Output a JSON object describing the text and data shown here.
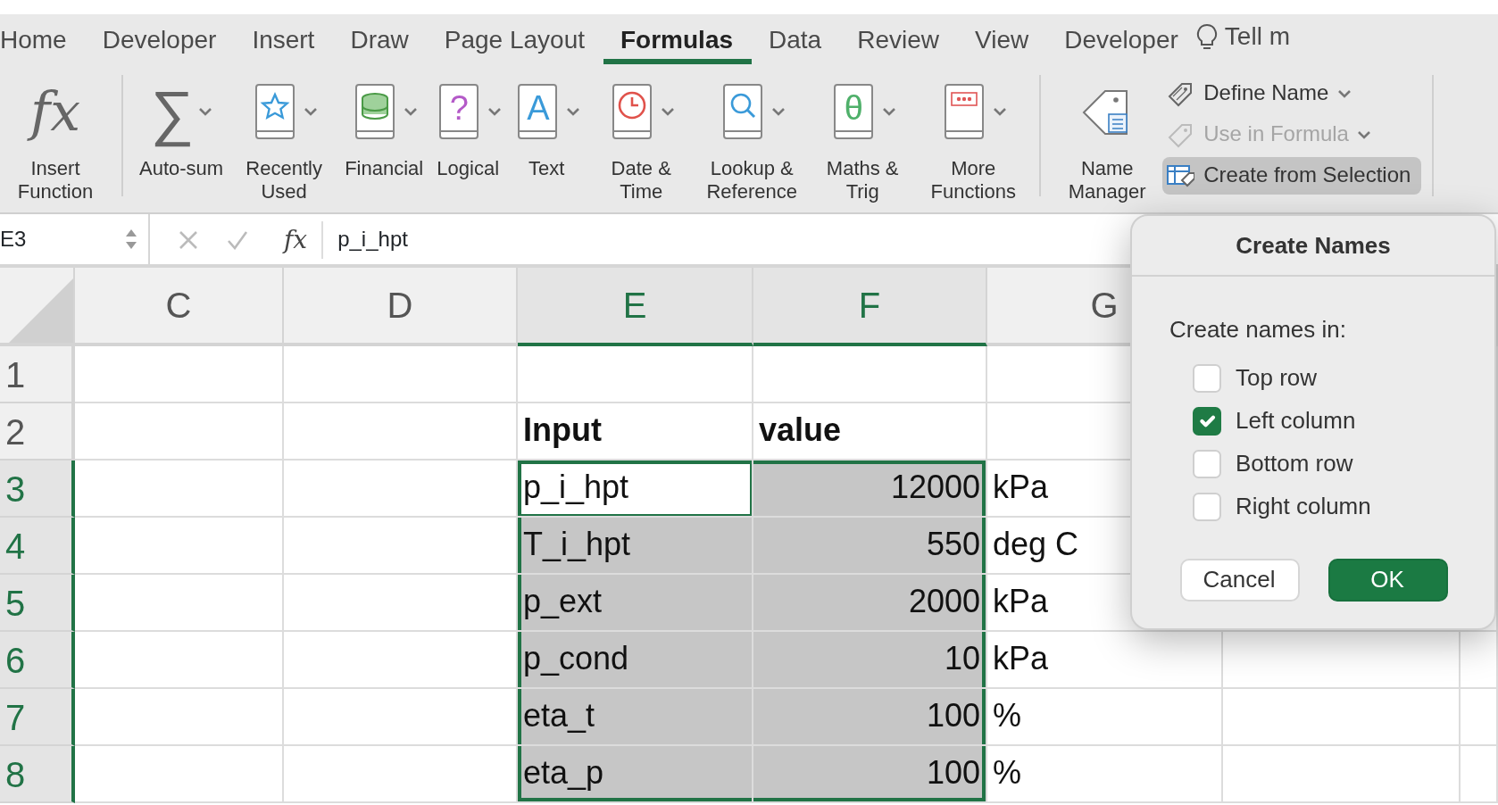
{
  "tabs": [
    {
      "label": "Home",
      "selected": false
    },
    {
      "label": "Developer",
      "selected": false
    },
    {
      "label": "Insert",
      "selected": false
    },
    {
      "label": "Draw",
      "selected": false
    },
    {
      "label": "Page Layout",
      "selected": false
    },
    {
      "label": "Formulas",
      "selected": true
    },
    {
      "label": "Data",
      "selected": false
    },
    {
      "label": "Review",
      "selected": false
    },
    {
      "label": "View",
      "selected": false
    },
    {
      "label": "Developer",
      "selected": false
    }
  ],
  "tell_me": "Tell m",
  "ribbon": {
    "insert_function": {
      "glyph": "fx",
      "label": "Insert Function"
    },
    "function_library": [
      {
        "label": "Auto-sum",
        "glyph": "∑"
      },
      {
        "label": "Recently Used"
      },
      {
        "label": "Financial"
      },
      {
        "label": "Logical",
        "glyph": "?"
      },
      {
        "label": "Text",
        "glyph": "A"
      },
      {
        "label": "Date & Time"
      },
      {
        "label": "Lookup & Reference"
      },
      {
        "label": "Maths & Trig",
        "glyph": "θ"
      },
      {
        "label": "More Functions"
      }
    ],
    "name_manager": {
      "label": "Name Manager"
    },
    "name_commands": [
      {
        "label": "Define Name",
        "disabled": false,
        "selected": false,
        "dropdown": true
      },
      {
        "label": "Use in Formula",
        "disabled": true,
        "selected": false,
        "dropdown": true
      },
      {
        "label": "Create from Selection",
        "disabled": false,
        "selected": true,
        "dropdown": false
      }
    ]
  },
  "formula_bar": {
    "name_box": "E3",
    "fx": "fx",
    "formula": "p_i_hpt"
  },
  "sheet": {
    "columns": [
      {
        "label": "C",
        "selected": false
      },
      {
        "label": "D",
        "selected": false
      },
      {
        "label": "E",
        "selected": true
      },
      {
        "label": "F",
        "selected": true
      },
      {
        "label": "G",
        "selected": false
      }
    ],
    "rows": [
      {
        "number": "1",
        "selected": false,
        "cells": [
          {
            "selected": false,
            "active": false
          },
          {
            "selected": false,
            "active": false
          },
          {
            "selected": false,
            "active": false
          },
          {
            "selected": false,
            "active": false
          },
          {
            "selected": false,
            "active": false
          }
        ]
      },
      {
        "number": "2",
        "selected": false,
        "cells": [
          {
            "selected": false,
            "active": false
          },
          {
            "selected": false,
            "active": false
          },
          {
            "text": "Input",
            "kind": "heading",
            "selected": false,
            "active": false
          },
          {
            "text": "value",
            "kind": "heading",
            "selected": false,
            "active": false
          },
          {
            "selected": false,
            "active": false
          }
        ]
      },
      {
        "number": "3",
        "selected": true,
        "cells": [
          {
            "selected": false,
            "active": false
          },
          {
            "selected": false,
            "active": false
          },
          {
            "text": "p_i_hpt",
            "kind": "text",
            "selected": true,
            "active": true
          },
          {
            "text": "12000",
            "kind": "number",
            "selected": true,
            "active": false
          },
          {
            "text": "kPa",
            "kind": "text",
            "selected": false,
            "active": false
          }
        ]
      },
      {
        "number": "4",
        "selected": true,
        "cells": [
          {
            "selected": false,
            "active": false
          },
          {
            "selected": false,
            "active": false
          },
          {
            "text": "T_i_hpt",
            "kind": "text",
            "selected": true,
            "active": false
          },
          {
            "text": "550",
            "kind": "number",
            "selected": true,
            "active": false
          },
          {
            "text": "deg C",
            "kind": "text",
            "selected": false,
            "active": false
          }
        ]
      },
      {
        "number": "5",
        "selected": true,
        "cells": [
          {
            "selected": false,
            "active": false
          },
          {
            "selected": false,
            "active": false
          },
          {
            "text": "p_ext",
            "kind": "text",
            "selected": true,
            "active": false
          },
          {
            "text": "2000",
            "kind": "number",
            "selected": true,
            "active": false
          },
          {
            "text": "kPa",
            "kind": "text",
            "selected": false,
            "active": false
          }
        ]
      },
      {
        "number": "6",
        "selected": true,
        "cells": [
          {
            "selected": false,
            "active": false
          },
          {
            "selected": false,
            "active": false
          },
          {
            "text": "p_cond",
            "kind": "text",
            "selected": true,
            "active": false
          },
          {
            "text": "10",
            "kind": "number",
            "selected": true,
            "active": false
          },
          {
            "text": "kPa",
            "kind": "text",
            "selected": false,
            "active": false
          }
        ]
      },
      {
        "number": "7",
        "selected": true,
        "cells": [
          {
            "selected": false,
            "active": false
          },
          {
            "selected": false,
            "active": false
          },
          {
            "text": "eta_t",
            "kind": "text",
            "selected": true,
            "active": false
          },
          {
            "text": "100",
            "kind": "number",
            "selected": true,
            "active": false
          },
          {
            "text": "%",
            "kind": "text",
            "selected": false,
            "active": false
          }
        ]
      },
      {
        "number": "8",
        "selected": true,
        "cells": [
          {
            "selected": false,
            "active": false
          },
          {
            "selected": false,
            "active": false
          },
          {
            "text": "eta_p",
            "kind": "text",
            "selected": true,
            "active": false
          },
          {
            "text": "100",
            "kind": "number",
            "selected": true,
            "active": false
          },
          {
            "text": "%",
            "kind": "text",
            "selected": false,
            "active": false
          }
        ]
      }
    ]
  },
  "dialog": {
    "title": "Create Names",
    "prompt": "Create names in:",
    "options": [
      {
        "label": "Top row",
        "checked": false
      },
      {
        "label": "Left column",
        "checked": true
      },
      {
        "label": "Bottom row",
        "checked": false
      },
      {
        "label": "Right column",
        "checked": false
      }
    ],
    "buttons": [
      {
        "label": "Cancel",
        "kind": "secondary"
      },
      {
        "label": "OK",
        "kind": "primary"
      }
    ]
  }
}
